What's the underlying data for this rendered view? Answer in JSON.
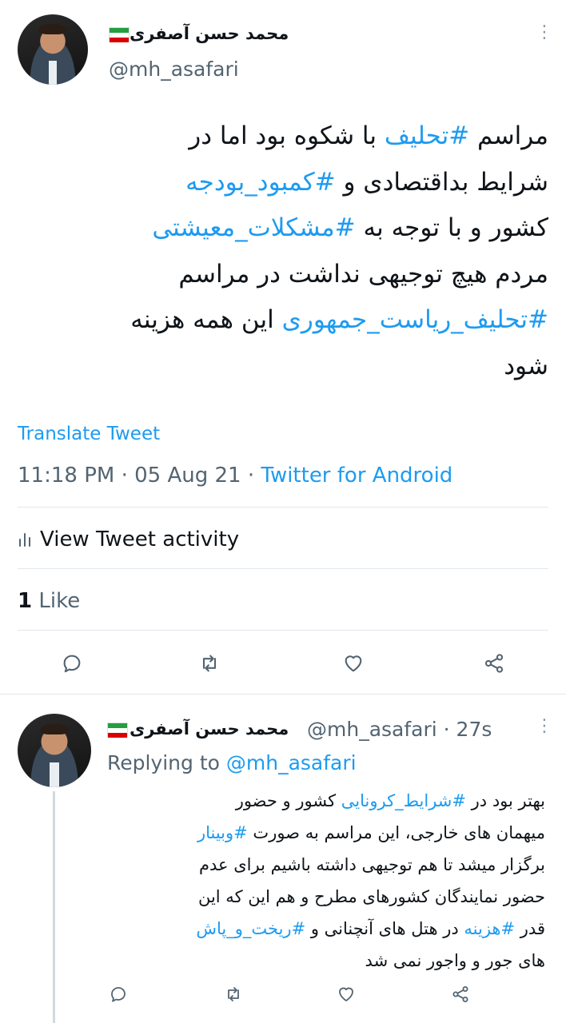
{
  "main_tweet": {
    "author_name": "محمد حسن آصفری",
    "handle": "@mh_asafari",
    "text_lines": [
      [
        {
          "t": "مراسم "
        },
        {
          "t": "#تحلیف",
          "tag": true
        },
        {
          "t": " با شکوه بود اما در"
        }
      ],
      [
        {
          "t": "شرایط بداقتصادی و "
        },
        {
          "t": "#کمبود_بودجه",
          "tag": true
        }
      ],
      [
        {
          "t": "کشور و با توجه به "
        },
        {
          "t": "#مشکلات_معیشتی",
          "tag": true
        }
      ],
      [
        {
          "t": "مردم هیچ توجیهی نداشت در مراسم"
        }
      ],
      [
        {
          "t": "#تحلیف_ریاست_جمهوری",
          "tag": true
        },
        {
          "t": " این همه هزینه"
        }
      ],
      [
        {
          "t": "شود"
        }
      ]
    ],
    "translate_label": "Translate Tweet",
    "timestamp": "11:18 PM · 05 Aug 21 · ",
    "source": "Twitter for Android",
    "activity_label": "View Tweet activity",
    "like_count": "1",
    "like_label": " Like"
  },
  "reply_tweet": {
    "author_name": "محمد حسن آصفری",
    "handle_time": "@mh_asafari · 27s",
    "replying_prefix": "Replying to ",
    "replying_handle": "@mh_asafari",
    "text_lines": [
      [
        {
          "t": "بهتر بود در "
        },
        {
          "t": "#شرایط_کرونایی",
          "tag": true
        },
        {
          "t": " کشور و حضور"
        }
      ],
      [
        {
          "t": "میهمان های خارجی، این مراسم به صورت "
        },
        {
          "t": "#وبینار",
          "tag": true
        }
      ],
      [
        {
          "t": "برگزار میشد تا هم توجیهی داشته باشیم برای عدم"
        }
      ],
      [
        {
          "t": "حضور نمایندگان کشورهای مطرح و هم این که این"
        }
      ],
      [
        {
          "t": "قدر "
        },
        {
          "t": "#هزینه",
          "tag": true
        },
        {
          "t": " در هتل های آنچنانی و "
        },
        {
          "t": "#ریخت_و_پاش",
          "tag": true
        }
      ],
      [
        {
          "t": "های جور و واجور نمی شد"
        }
      ]
    ]
  },
  "icons": [
    "reply-icon",
    "retweet-icon",
    "like-icon",
    "share-icon",
    "more-icon",
    "bar-chart-icon",
    "iran-flag-icon"
  ],
  "colors": {
    "link": "#1d9bf0",
    "muted": "#536471",
    "text": "#0f1419"
  }
}
